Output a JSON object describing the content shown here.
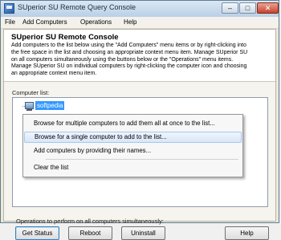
{
  "window": {
    "title": "SUperior SU Remote Query Console",
    "buttons": {
      "minimize": "–",
      "maximize": "□",
      "close": "✕"
    }
  },
  "menubar": {
    "items": [
      "File",
      "Add Computers",
      "Operations",
      "Help"
    ]
  },
  "header": {
    "title": "SUperior SU Remote Console",
    "lines": [
      "Add computers to the list below using the \"Add Computers\" menu items or by right-clicking into",
      "the free space in the list and choosing an appropriate context menu item. Manage SUperior SU",
      "on all computers simultaneously using the buttons below or the \"Operations\" menu items.",
      "Manage SUperior SU on individual computers by right-clicking the computer icon and choosing",
      "an appropriate context menu item."
    ]
  },
  "computer_list": {
    "label": "Computer list:",
    "items": [
      {
        "name": "softpedia",
        "icon": "computer-icon"
      }
    ]
  },
  "context_menu": {
    "items": [
      "Browse for multiple computers to add them all at once to the list...",
      "Browse for a single computer to add to the list...",
      "Add computers by providing their names...",
      "Clear the list"
    ],
    "hovered_index": 1
  },
  "operations": {
    "label": "Operations to perform on all computers simultaneously:",
    "buttons": {
      "get_status": "Get Status",
      "reboot": "Reboot",
      "uninstall": "Uninstall",
      "help": "Help"
    }
  },
  "colors": {
    "selection": "#3399ff",
    "hover_highlight": "#d8e6f7"
  }
}
